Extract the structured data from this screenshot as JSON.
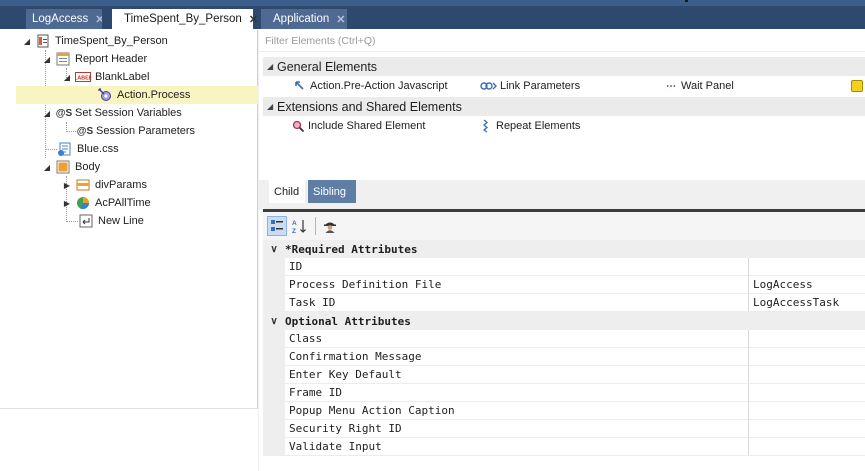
{
  "tabs": [
    {
      "label": "LogAccess",
      "close": "✕"
    },
    {
      "label": "TimeSpent_By_Person",
      "close": "✕"
    },
    {
      "label": "Application",
      "close": "✕"
    }
  ],
  "tree": {
    "root": "TimeSpent_By_Person",
    "report_header": "Report Header",
    "blank_label": "BlankLabel",
    "blank_label_icon": "LABEL",
    "action_process": "Action.Process",
    "set_session_variables": "Set Session Variables",
    "session_parameters": "Session Parameters",
    "session_icon": "@S",
    "blue_css": "Blue.css",
    "body": "Body",
    "div_params": "divParams",
    "ac_all_time": "AcPAllTime",
    "new_line": "New Line"
  },
  "filter": {
    "placeholder": "Filter Elements (Ctrl+Q)"
  },
  "palette": {
    "general": "General Elements",
    "items_general": [
      "Action.Pre-Action Javascript",
      "Link Parameters",
      "Wait Panel"
    ],
    "extensions": "Extensions and Shared Elements",
    "items_ext": [
      "Include Shared Element",
      "Repeat Elements"
    ]
  },
  "relation_tabs": {
    "child": "Child",
    "sibling": "Sibling"
  },
  "props": {
    "required_header": "*Required Attributes",
    "required": [
      {
        "name": "ID",
        "value": ""
      },
      {
        "name": "Process Definition File",
        "value": "LogAccess"
      },
      {
        "name": "Task ID",
        "value": "LogAccessTask"
      }
    ],
    "optional_header": "Optional Attributes",
    "optional": [
      {
        "name": "Class",
        "value": ""
      },
      {
        "name": "Confirmation Message",
        "value": ""
      },
      {
        "name": "Enter Key Default",
        "value": ""
      },
      {
        "name": "Frame ID",
        "value": ""
      },
      {
        "name": "Popup Menu Action Caption",
        "value": ""
      },
      {
        "name": "Security Right ID",
        "value": ""
      },
      {
        "name": "Validate Input",
        "value": ""
      }
    ]
  },
  "colors": {
    "tabstrip": "#2d4a6e",
    "selected_node": "#f8f5c0",
    "sibling_tab": "#5f7ea6"
  }
}
